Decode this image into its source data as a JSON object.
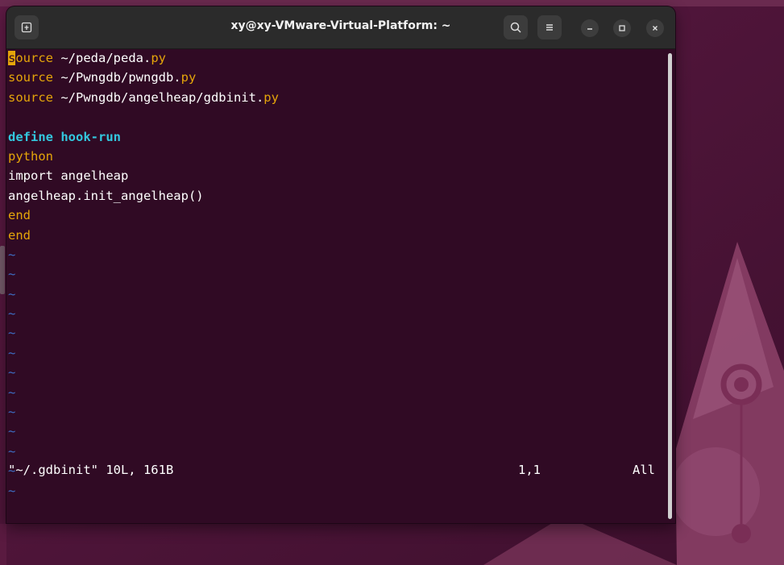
{
  "window": {
    "title": "xy@xy-VMware-Virtual-Platform: ~",
    "new_tab_icon": "new-tab-icon",
    "search_icon": "search-icon",
    "menu_icon": "hamburger-menu-icon",
    "minimize_icon": "minimize-icon",
    "maximize_icon": "maximize-icon",
    "close_icon": "close-icon"
  },
  "editor": {
    "lines": [
      {
        "cursor_char": "s",
        "segments": [
          {
            "text": "ource",
            "style": "orange"
          },
          {
            "text": " ~/peda/peda.",
            "style": "plain"
          },
          {
            "text": "py",
            "style": "orange"
          }
        ]
      },
      {
        "segments": [
          {
            "text": "source",
            "style": "orange"
          },
          {
            "text": " ~/Pwngdb/pwngdb.",
            "style": "plain"
          },
          {
            "text": "py",
            "style": "orange"
          }
        ]
      },
      {
        "segments": [
          {
            "text": "source",
            "style": "orange"
          },
          {
            "text": " ~/Pwngdb/angelheap/gdbinit.",
            "style": "plain"
          },
          {
            "text": "py",
            "style": "orange"
          }
        ]
      },
      {
        "segments": []
      },
      {
        "segments": [
          {
            "text": "define hook-run",
            "style": "define"
          }
        ]
      },
      {
        "segments": [
          {
            "text": "python",
            "style": "orange"
          }
        ]
      },
      {
        "segments": [
          {
            "text": "import angelheap",
            "style": "plain"
          }
        ]
      },
      {
        "segments": [
          {
            "text": "angelheap.init_angelheap()",
            "style": "plain"
          }
        ]
      },
      {
        "segments": [
          {
            "text": "end",
            "style": "orange"
          }
        ]
      },
      {
        "segments": [
          {
            "text": "end",
            "style": "orange"
          }
        ]
      }
    ],
    "tilde": "~",
    "tilde_count": 13
  },
  "statusline": {
    "file_info": "\"~/.gdbinit\" 10L, 161B",
    "position": "1,1",
    "scroll": "All"
  },
  "colors": {
    "terminal_bg": "#300a24",
    "keyword_orange": "#e5a50a",
    "define_cyan": "#33c7de",
    "tilde_blue": "#3e6ec5",
    "titlebar_bg": "#2b2b2b"
  }
}
